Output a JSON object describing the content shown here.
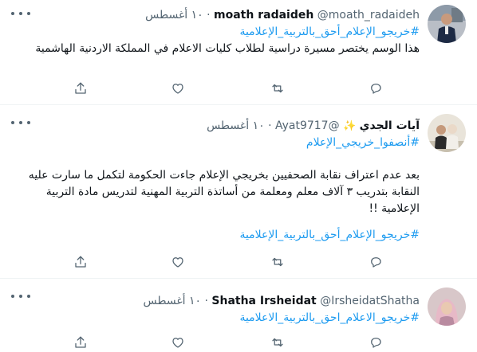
{
  "tweets": [
    {
      "name": "moath radaideh",
      "handle": "@moath_radaideh",
      "separator": "·",
      "time": "١٠ أغسطس",
      "hashtag": "#خريجو_الإعلام_أحق_بالتربية_الإعلامية",
      "text": "هذا الوسم يختصر مسيرة دراسية لطلاب كليات الاعلام في المملكة الاردنية الهاشمية"
    },
    {
      "name": "آيات الجدي",
      "handle": "@Ayat9717",
      "separator": "·",
      "time": "١٠ أغسطس",
      "hashtag": "#أنصفوا_خريجي_الإعلام",
      "text": "بعد عدم اعتراف نقابة الصحفيين بخريجي الإعلام  جاءت الحكومة لتكمل ما سارت عليه النقابة بتدريب ٣ آلاف معلم ومعلمة من أساتذة التربية المهنية لتدريس مادة التربية الإعلامية !!",
      "hashtag2": "#خريجو_الإعلام_أحق_بالتربية_الإعلامية"
    },
    {
      "name": "Shatha Irsheidat",
      "handle": "@IrsheidatShatha",
      "separator": "·",
      "time": "١٠ أغسطس",
      "hashtag": "#خريجو_الاعلام_احق_بالتربية_الاعلامية"
    }
  ],
  "icons": {
    "reply": "reply-icon",
    "retweet": "retweet-icon",
    "like": "like-icon",
    "share": "share-icon",
    "more": "more-icon"
  },
  "colors": {
    "link": "#1d9bf0",
    "secondary": "#536471",
    "text": "#0f1419",
    "border": "#eff3f4"
  }
}
